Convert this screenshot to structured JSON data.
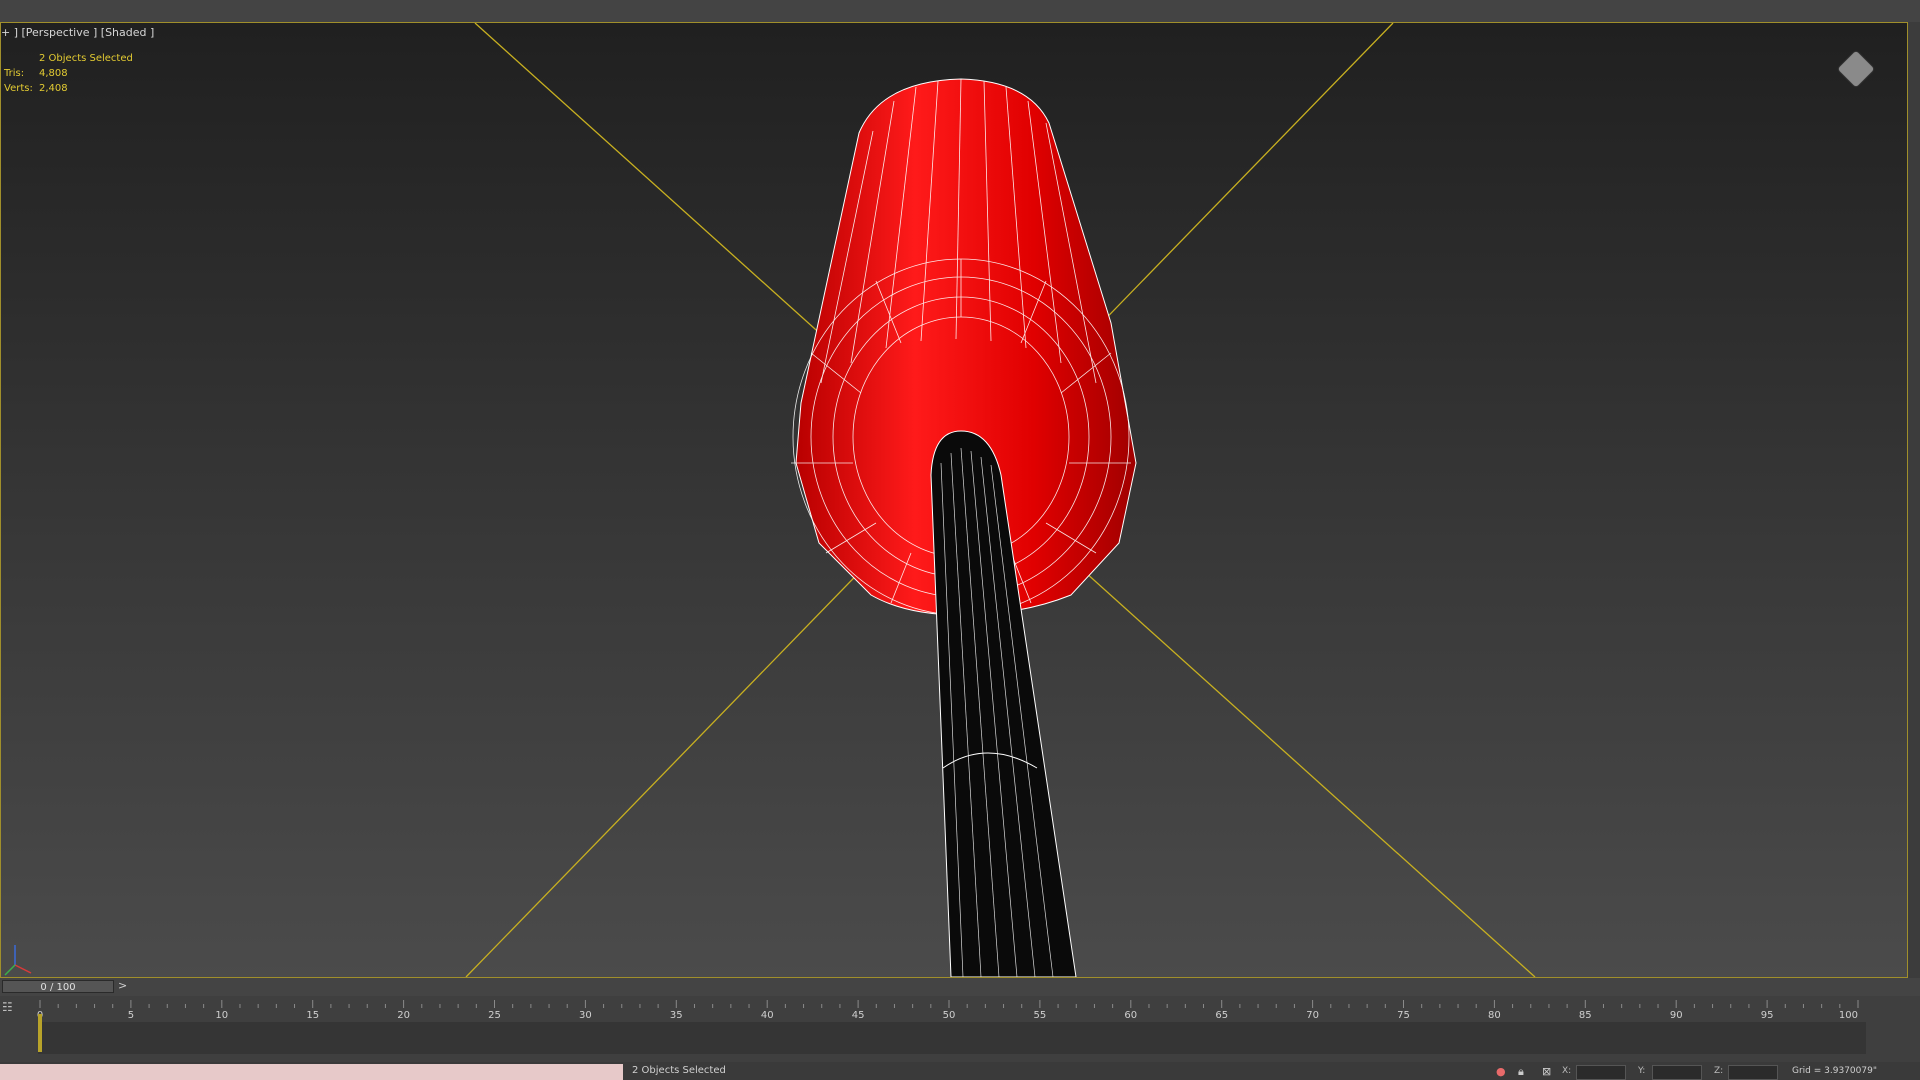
{
  "viewport": {
    "label": "+ ] [Perspective ] [Shaded ]",
    "stats": {
      "selection": "2 Objects Selected",
      "tris_label": "Tris:",
      "tris_value": "4,808",
      "verts_label": "Verts:",
      "verts_value": "2,408"
    },
    "nav_cube_icon": "viewcube-icon",
    "axis_gizmo_icon": "xyz-axis-gizmo-icon",
    "accent_color": "#a08f2b",
    "object_color": "#dd0000"
  },
  "timeslider": {
    "label": "0 / 100",
    "next_icon": ">"
  },
  "trackbar": {
    "icon": "timeline-filter-icon",
    "ticks": [
      "0",
      "5",
      "10",
      "15",
      "20",
      "25",
      "30",
      "35",
      "40",
      "45",
      "50",
      "55",
      "60",
      "65",
      "70",
      "75",
      "80",
      "85",
      "90",
      "95",
      "100"
    ]
  },
  "status_bar": {
    "prompt": "2 Objects Selected",
    "x_label": "X:",
    "y_label": "Y:",
    "z_label": "Z:",
    "grid": "Grid = 3.9370079\""
  }
}
